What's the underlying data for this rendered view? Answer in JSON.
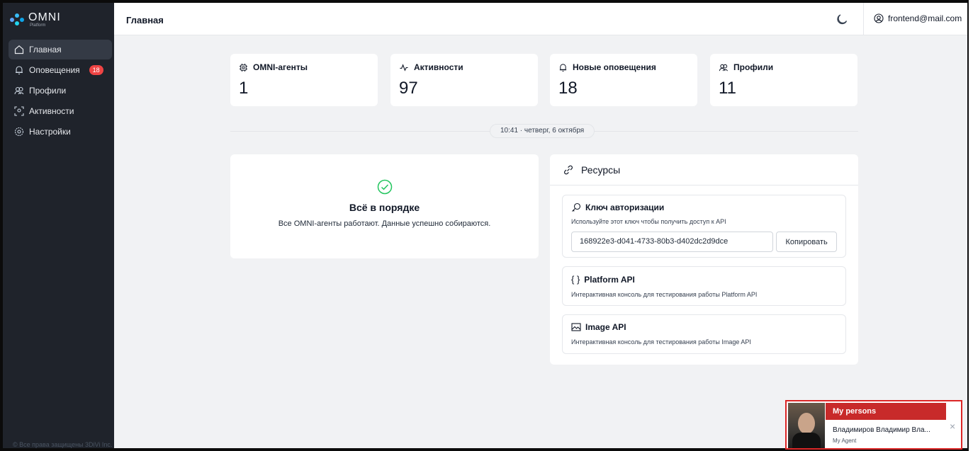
{
  "app": {
    "logo_text": "OMNI",
    "logo_sub": "Platform",
    "copyright": "© Все права защищены 3DiVi Inc."
  },
  "sidebar": {
    "items": [
      {
        "label": "Главная",
        "icon": "home-icon",
        "active": true
      },
      {
        "label": "Оповещения",
        "icon": "bell-icon",
        "badge": "18"
      },
      {
        "label": "Профили",
        "icon": "users-icon"
      },
      {
        "label": "Активности",
        "icon": "scan-face-icon"
      },
      {
        "label": "Настройки",
        "icon": "gear-icon"
      }
    ]
  },
  "header": {
    "title": "Главная",
    "user_email": "frontend@mail.com"
  },
  "stats": [
    {
      "label": "OMNI-агенты",
      "value": "1",
      "icon": "chip-icon"
    },
    {
      "label": "Активности",
      "value": "97",
      "icon": "activity-icon"
    },
    {
      "label": "Новые оповещения",
      "value": "18",
      "icon": "bell-icon"
    },
    {
      "label": "Профили",
      "value": "11",
      "icon": "users-icon"
    }
  ],
  "date_label": "10:41 · четверг, 6 октября",
  "status": {
    "title": "Всё в порядке",
    "text": "Все OMNI-агенты работают. Данные успешно собираются."
  },
  "resources": {
    "title": "Ресурсы",
    "auth": {
      "title": "Ключ авторизации",
      "desc": "Используйте этот ключ чтобы получить доступ к API",
      "key": "168922e3-d041-4733-80b3-d402dc2d9dce",
      "copy_label": "Копировать"
    },
    "platform_api": {
      "title": "Platform API",
      "desc": "Интерактивная консоль для тестирования работы Platform API"
    },
    "image_api": {
      "title": "Image API",
      "desc": "Интерактивная консоль для тестирования работы Image API"
    }
  },
  "toast": {
    "title": "My persons",
    "name": "Владимиров Владимир Вла...",
    "subtitle": "My Agent",
    "close": "×"
  },
  "colors": {
    "sidebar_bg": "#1f232b",
    "main_bg": "#f1f2f4",
    "badge": "#ef4444",
    "success": "#22c55e",
    "toast_header": "#c82a2a"
  }
}
